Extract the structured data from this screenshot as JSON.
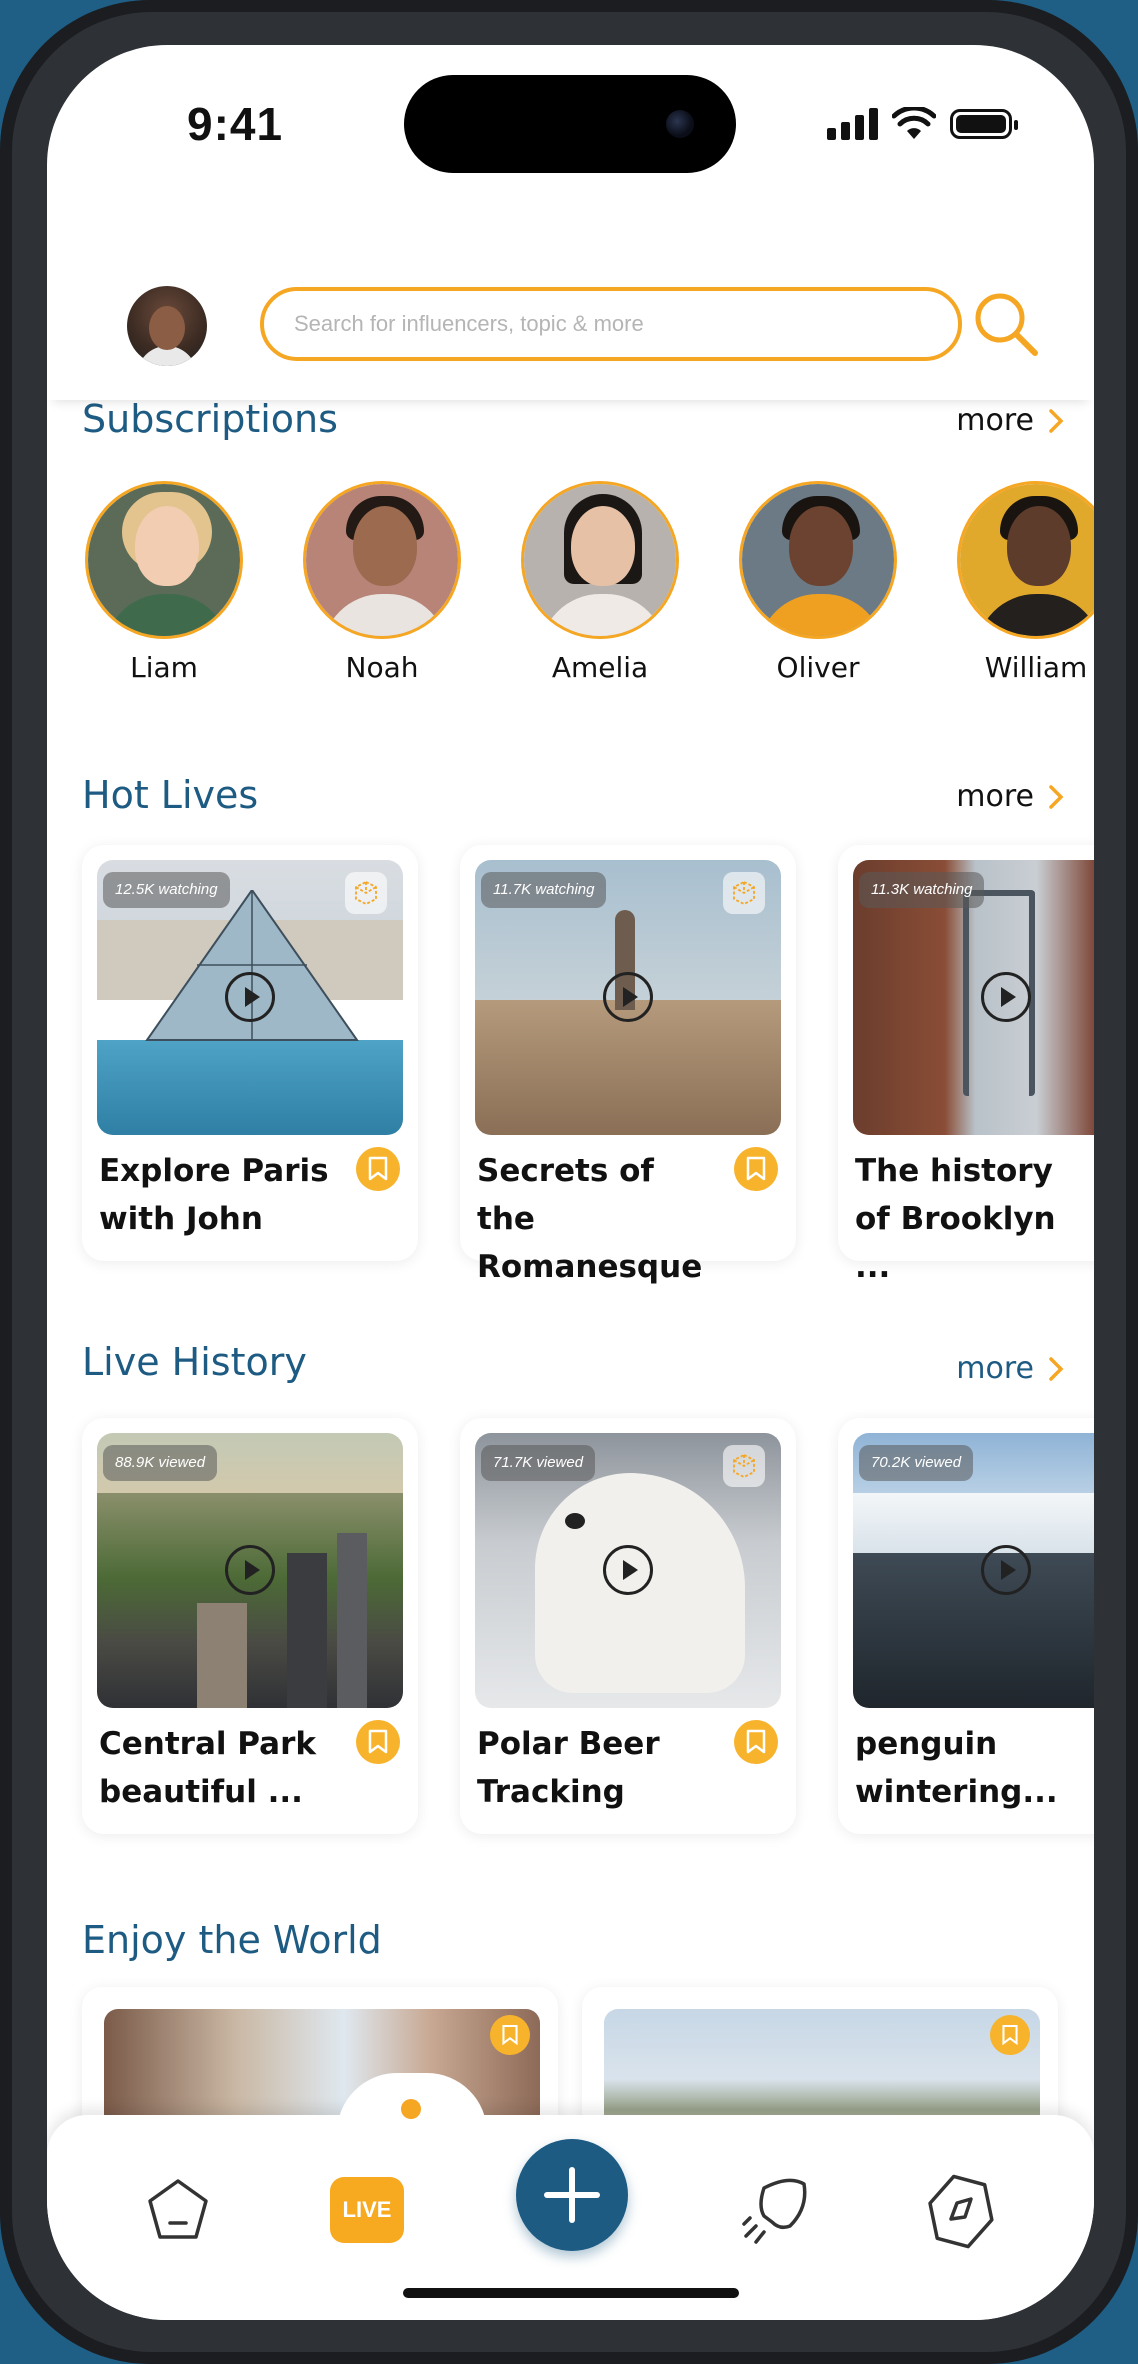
{
  "status": {
    "time": "9:41"
  },
  "search": {
    "placeholder": "Search for influencers, topic & more"
  },
  "subscriptions": {
    "title": "Subscriptions",
    "more": "more",
    "people": [
      {
        "name": "Liam"
      },
      {
        "name": "Noah"
      },
      {
        "name": "Amelia"
      },
      {
        "name": "Oliver"
      },
      {
        "name": "William"
      }
    ]
  },
  "hot_lives": {
    "title": "Hot Lives",
    "more": "more",
    "cards": [
      {
        "badge": "12.5K watching",
        "title": "Explore Paris with John"
      },
      {
        "badge": "11.7K watching",
        "title": "Secrets of the Romanesque"
      },
      {
        "badge": "11.3K watching",
        "title": "The history of Brooklyn ..."
      }
    ]
  },
  "live_history": {
    "title": "Live History",
    "more": "more",
    "cards": [
      {
        "badge": "88.9K viewed",
        "title": "Central Park beautiful ..."
      },
      {
        "badge": "71.7K viewed",
        "title": "Polar Beer Tracking"
      },
      {
        "badge": "70.2K viewed",
        "title": "penguin wintering..."
      }
    ]
  },
  "enjoy": {
    "title": "Enjoy the World"
  },
  "nav": {
    "live_label": "LIVE"
  },
  "colors": {
    "accent": "#f5a623",
    "brand": "#1e5b83"
  }
}
